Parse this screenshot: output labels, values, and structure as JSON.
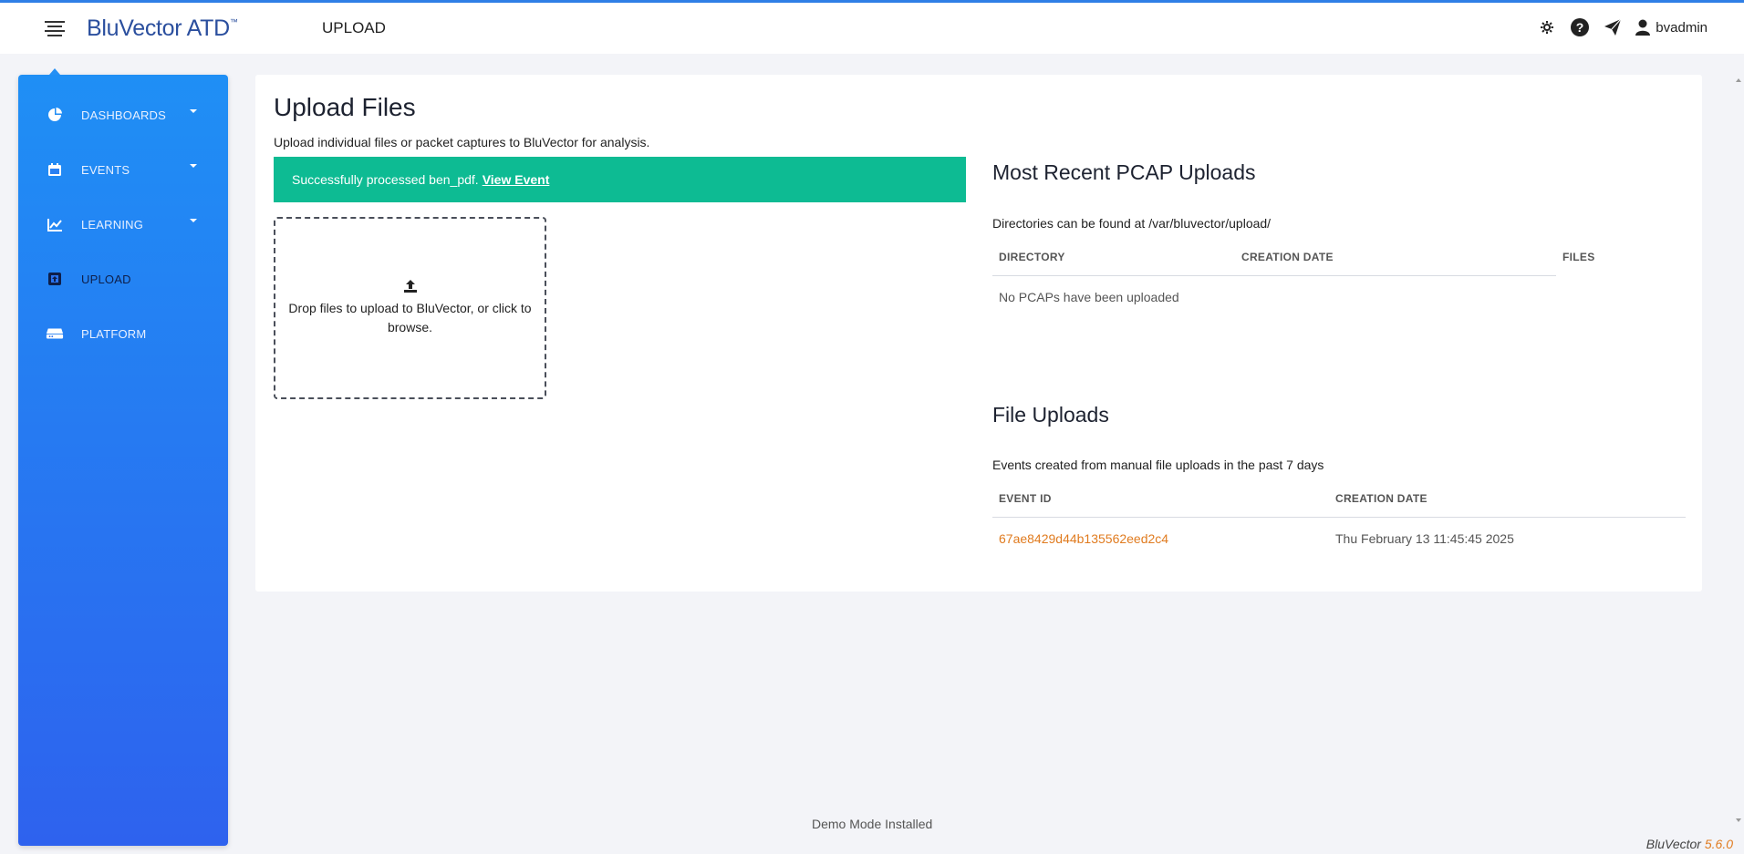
{
  "header": {
    "logo_text": "BluVector ATD",
    "logo_tm": "™",
    "page_title": "UPLOAD",
    "icons": [
      "settings-gear-icon",
      "help-icon",
      "send-icon",
      "user-icon"
    ],
    "username": "bvadmin"
  },
  "sidebar": {
    "items": [
      {
        "label": "DASHBOARDS",
        "icon": "pie-chart-icon",
        "has_dropdown": true,
        "active": false
      },
      {
        "label": "EVENTS",
        "icon": "calendar-icon",
        "has_dropdown": true,
        "active": false
      },
      {
        "label": "LEARNING",
        "icon": "line-chart-icon",
        "has_dropdown": true,
        "active": false
      },
      {
        "label": "UPLOAD",
        "icon": "upload-icon",
        "has_dropdown": false,
        "active": true
      },
      {
        "label": "PLATFORM",
        "icon": "server-icon",
        "has_dropdown": false,
        "active": false
      }
    ]
  },
  "main": {
    "title": "Upload Files",
    "subtitle": "Upload individual files or packet captures to BluVector for analysis.",
    "alert": {
      "message": "Successfully processed ben_pdf.",
      "link_label": "View Event",
      "color": "#0dbb93"
    },
    "dropzone": {
      "text": "Drop files to upload to BluVector, or click to browse.",
      "icon": "upload-arrow-icon"
    },
    "pcap": {
      "title": "Most Recent PCAP Uploads",
      "note": "Directories can be found at /var/bluvector/upload/",
      "columns": [
        "DIRECTORY",
        "CREATION DATE",
        "FILES"
      ],
      "empty_message": "No PCAPs have been uploaded"
    },
    "files": {
      "title": "File Uploads",
      "note": "Events created from manual file uploads in the past 7 days",
      "columns": [
        "EVENT ID",
        "CREATION DATE"
      ],
      "rows": [
        {
          "event_id": "67ae8429d44b135562eed2c4",
          "creation_date": "Thu February 13 11:45:45 2025"
        }
      ]
    }
  },
  "footer": {
    "demo_note": "Demo Mode Installed",
    "brand": "BluVector",
    "version": "5.6.0"
  },
  "colors": {
    "accent": "#2f7fe6",
    "link": "#e07b1f",
    "success": "#0dbb93"
  }
}
